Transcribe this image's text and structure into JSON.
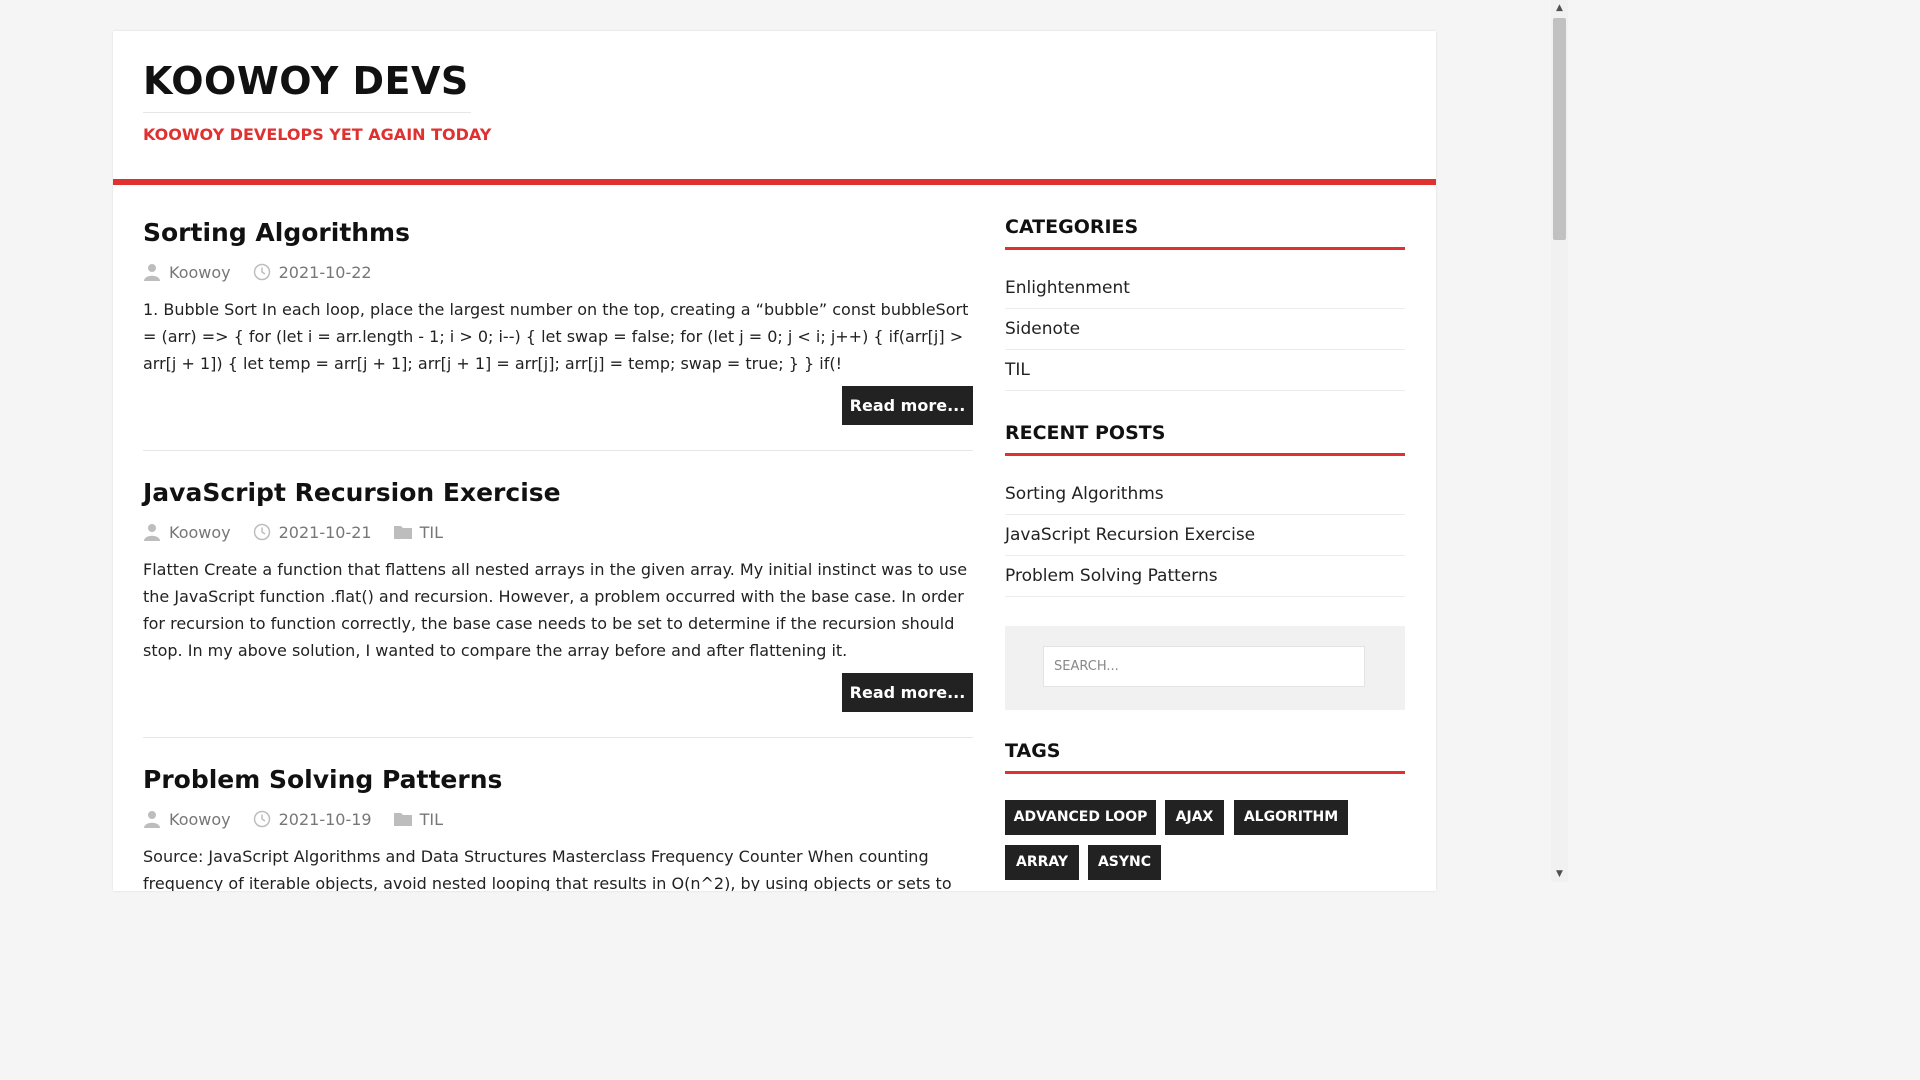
{
  "site": {
    "title": "KOOWOY DEVS",
    "tagline": "KOOWOY DEVELOPS YET AGAIN TODAY"
  },
  "colors": {
    "accent": "#e03131",
    "button_bg": "#222222",
    "meta_text": "#777777"
  },
  "posts": [
    {
      "title": "Sorting Algorithms",
      "author": "Koowoy",
      "date": "2021-10-22",
      "category": "",
      "excerpt": "1. Bubble Sort In each loop, place the largest number on the top, creating a “bubble” const bubbleSort = (arr) => { for (let i = arr.length - 1; i > 0; i--) { let swap = false; for (let j = 0; j < i; j++) { if(arr[j] > arr[j + 1]) { let temp = arr[j + 1]; arr[j + 1] = arr[j]; arr[j] = temp; swap = true; } } if(!",
      "read_more": "Read more..."
    },
    {
      "title": "JavaScript Recursion Exercise",
      "author": "Koowoy",
      "date": "2021-10-21",
      "category": "TIL",
      "excerpt": "Flatten Create a function that flattens all nested arrays in the given array. My initial instinct was to use the JavaScript function .flat() and recursion. However, a problem occurred with the base case. In order for recursion to function correctly, the base case needs to be set to determine if the recursion should stop. In my above solution, I wanted to compare the array before and after flattening it.",
      "read_more": "Read more..."
    },
    {
      "title": "Problem Solving Patterns",
      "author": "Koowoy",
      "date": "2021-10-19",
      "category": "TIL",
      "excerpt": "Source: JavaScript Algorithms and Data Structures Masterclass Frequency Counter When counting frequency of iterable objects, avoid nested looping that results in O(n^2), by using objects or sets to"
    }
  ],
  "sidebar": {
    "categories": {
      "title": "CATEGORIES",
      "items": [
        "Enlightenment",
        "Sidenote",
        "TIL"
      ]
    },
    "recent_posts": {
      "title": "RECENT POSTS",
      "items": [
        "Sorting Algorithms",
        "JavaScript Recursion Exercise",
        "Problem Solving Patterns"
      ]
    },
    "search": {
      "placeholder": "SEARCH..."
    },
    "tags": {
      "title": "TAGS",
      "items": [
        "ADVANCED LOOP",
        "AJAX",
        "ALGORITHM",
        "ARRAY",
        "ASYNC"
      ]
    }
  },
  "icons": {
    "author": "user-icon",
    "date": "clock-icon",
    "category": "folder-icon",
    "scroll_up": "arrow-up-icon",
    "scroll_down": "arrow-down-icon"
  }
}
